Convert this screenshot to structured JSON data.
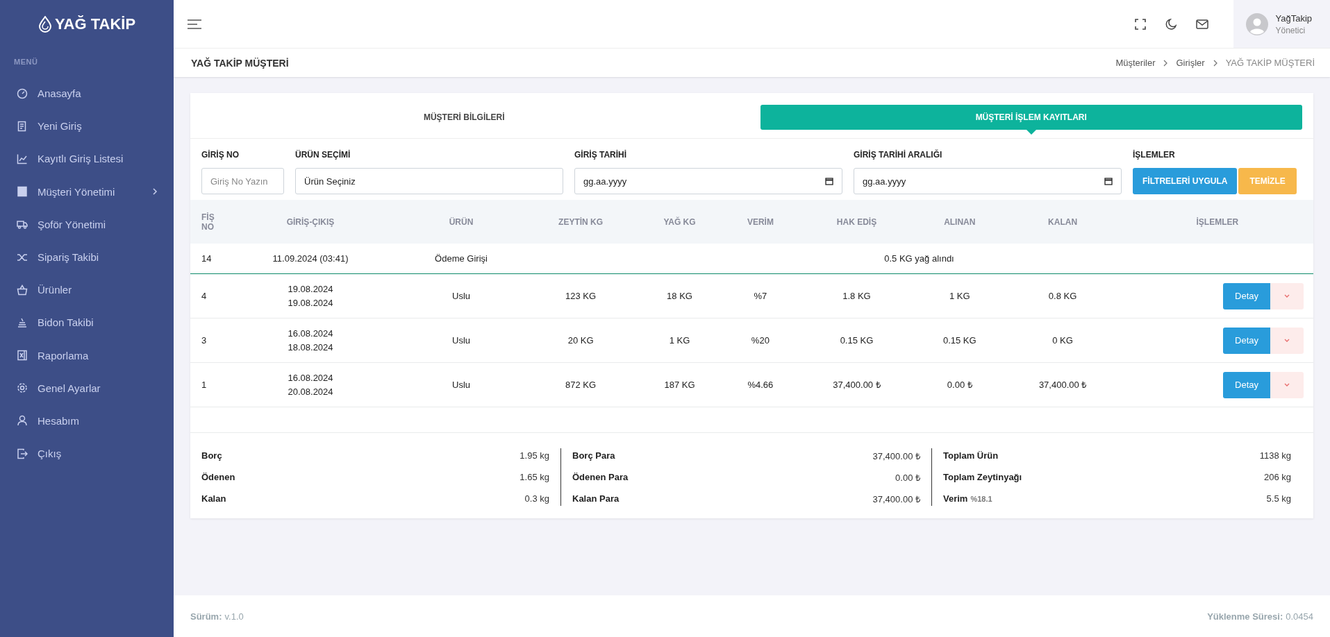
{
  "sidebar": {
    "logo": "YAĞ TAKİP",
    "section": "MENÜ",
    "items": [
      {
        "label": "Anasayfa",
        "has_submenu": false
      },
      {
        "label": "Yeni Giriş",
        "has_submenu": false
      },
      {
        "label": "Kayıtlı Giriş Listesi",
        "has_submenu": false
      },
      {
        "label": "Müşteri Yönetimi",
        "has_submenu": true
      },
      {
        "label": "Şoför Yönetimi",
        "has_submenu": false
      },
      {
        "label": "Sipariş Takibi",
        "has_submenu": false
      },
      {
        "label": "Ürünler",
        "has_submenu": false
      },
      {
        "label": "Bidon Takibi",
        "has_submenu": false
      },
      {
        "label": "Raporlama",
        "has_submenu": false
      },
      {
        "label": "Genel Ayarlar",
        "has_submenu": false
      },
      {
        "label": "Hesabım",
        "has_submenu": false
      },
      {
        "label": "Çıkış",
        "has_submenu": false
      }
    ]
  },
  "user": {
    "name": "YağTakip",
    "role": "Yönetici"
  },
  "page_title": "YAĞ TAKİP MÜŞTERİ",
  "breadcrumb": [
    {
      "label": "Müşteriler",
      "current": false
    },
    {
      "label": "Girişler",
      "current": false
    },
    {
      "label": "YAĞ TAKİP MÜŞTERİ",
      "current": true
    }
  ],
  "tabs": [
    {
      "label": "MÜŞTERİ BİLGİLERİ",
      "selected": false
    },
    {
      "label": "MÜŞTERİ İŞLEM KAYITLARI",
      "selected": true
    }
  ],
  "filters": {
    "giris_no": {
      "label": "GİRİŞ NO",
      "placeholder": "Giriş No Yazın"
    },
    "urun": {
      "label": "ÜRÜN SEÇİMİ",
      "value": "Ürün Seçiniz"
    },
    "tarih": {
      "label": "GİRİŞ TARİHİ",
      "value": "gg.aa.yyyy"
    },
    "aralik": {
      "label": "GİRİŞ TARİHİ ARALIĞI",
      "value": "gg.aa.yyyy"
    },
    "actions_label": "İŞLEMLER",
    "apply": "FİLTRELERİ UYGULA",
    "clear": "TEMİZLE"
  },
  "table": {
    "columns": [
      "FİŞ NO",
      "GİRİŞ-ÇIKIŞ",
      "ÜRÜN",
      "ZEYTİN KG",
      "YAĞ KG",
      "VERİM",
      "HAK EDİŞ",
      "ALINAN",
      "KALAN",
      "İŞLEMLER"
    ],
    "rows": [
      {
        "kind": "payment",
        "fis": "14",
        "dates": [
          "11.09.2024 (03:41)"
        ],
        "urun": "Ödeme Girişi",
        "note": "0.5 KG yağ alındı"
      },
      {
        "kind": "entry",
        "fis": "4",
        "dates": [
          "19.08.2024",
          "19.08.2024"
        ],
        "urun": "Uslu",
        "zeytin": "123 KG",
        "yag": "18 KG",
        "verim": "%7",
        "hak": "1.8 KG",
        "alinan": "1 KG",
        "kalan": "0.8 KG",
        "button": "Detay"
      },
      {
        "kind": "entry",
        "fis": "3",
        "dates": [
          "16.08.2024",
          "18.08.2024"
        ],
        "urun": "Uslu",
        "zeytin": "20 KG",
        "yag": "1 KG",
        "verim": "%20",
        "hak": "0.15 KG",
        "alinan": "0.15 KG",
        "kalan": "0 KG",
        "button": "Detay"
      },
      {
        "kind": "entry",
        "fis": "1",
        "dates": [
          "16.08.2024",
          "20.08.2024"
        ],
        "urun": "Uslu",
        "zeytin": "872 KG",
        "yag": "187 KG",
        "verim": "%4.66",
        "hak": "37,400.00 ₺",
        "alinan": "0.00 ₺",
        "kalan": "37,400.00 ₺",
        "button": "Detay"
      }
    ]
  },
  "summary": [
    [
      {
        "label": "Borç",
        "value": "1.95 kg"
      },
      {
        "label": "Ödenen",
        "value": "1.65 kg"
      },
      {
        "label": "Kalan",
        "value": "0.3 kg"
      }
    ],
    [
      {
        "label": "Borç Para",
        "value": "37,400.00 ₺"
      },
      {
        "label": "Ödenen Para",
        "value": "0.00 ₺"
      },
      {
        "label": "Kalan Para",
        "value": "37,400.00 ₺"
      }
    ],
    [
      {
        "label": "Toplam Ürün",
        "value": "1138 kg"
      },
      {
        "label": "Toplam Zeytinyağı",
        "value": "206 kg"
      },
      {
        "label": "Verim",
        "sub": "%18.1",
        "value": "5.5 kg"
      }
    ]
  ],
  "footer": {
    "version_label": "Sürüm:",
    "version": "v.1.0",
    "load_label": "Yüklenme Süresi:",
    "load": "0.0454"
  }
}
